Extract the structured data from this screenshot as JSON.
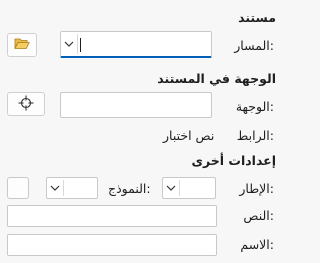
{
  "document": {
    "heading": "مستند",
    "path_label": "المسار:",
    "path_value": "",
    "browse_icon": "folder-open-icon"
  },
  "target": {
    "heading": "الوجهة في المستند",
    "target_label": "الوجهة:",
    "target_value": "",
    "pick_icon": "crosshair-icon",
    "link_label": "الرابط:",
    "link_value": "نص اختبار"
  },
  "other": {
    "heading": "إعدادات أخرى",
    "frame_label": "الإطار:",
    "frame_value": "",
    "form_label": "النموذج:",
    "form_value": "",
    "text_label": "النص:",
    "text_value": "",
    "name_label": "الاسم:",
    "name_value": ""
  },
  "colors": {
    "accent": "#005fb8",
    "folder": "#d9a62c"
  }
}
